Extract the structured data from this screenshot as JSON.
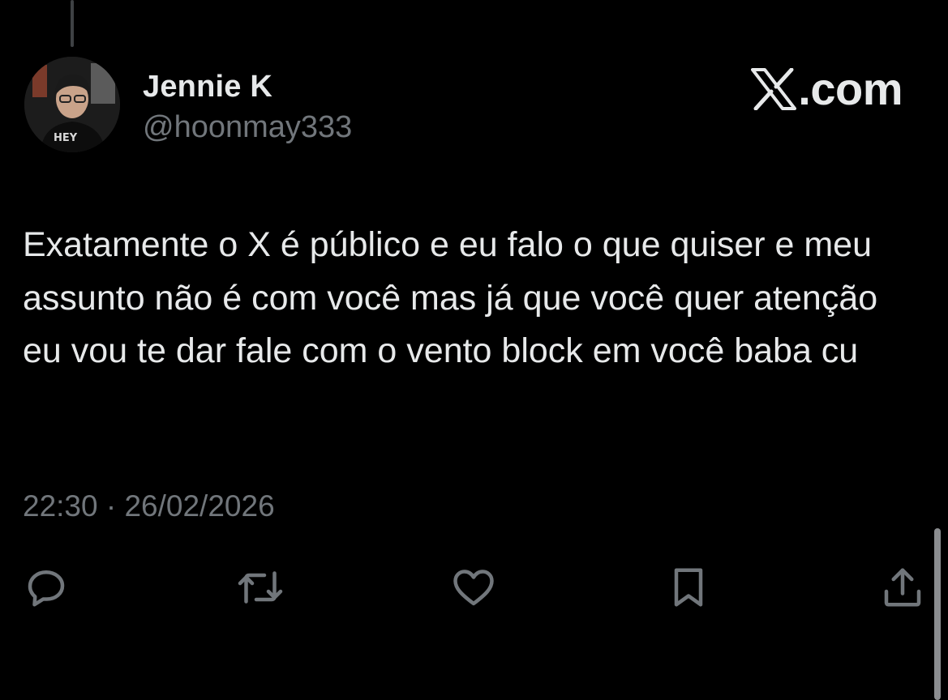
{
  "post": {
    "author_name": "Jennie K",
    "author_handle": "@hoonmay333",
    "avatar_shirt_text": "HEY",
    "text": "Exatamente o X é público e eu falo o que quiser e meu assunto não é com você mas já que você quer atenção eu vou te dar fale com o vento block em você baba cu",
    "timestamp": "22:30 · 26/02/2026"
  },
  "brand": {
    "logo_icon": "x-logo-icon",
    "text": ".com"
  },
  "actions": [
    {
      "icon": "reply-icon"
    },
    {
      "icon": "repost-icon"
    },
    {
      "icon": "like-icon"
    },
    {
      "icon": "bookmark-icon"
    },
    {
      "icon": "share-icon"
    }
  ],
  "colors": {
    "background": "#000000",
    "primary_text": "#e7e9ea",
    "secondary_text": "#71767b",
    "icon": "#71767b"
  }
}
